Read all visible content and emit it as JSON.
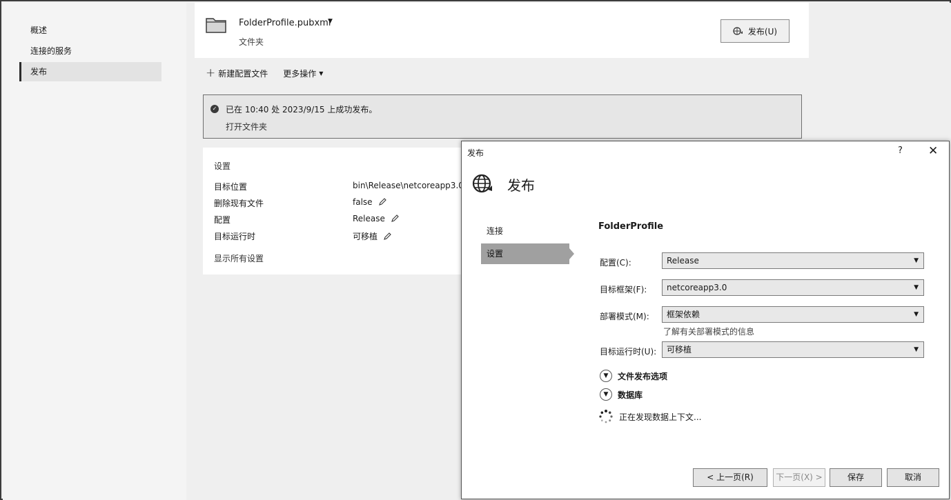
{
  "nav": {
    "items": [
      {
        "label": "概述"
      },
      {
        "label": "连接的服务"
      },
      {
        "label": "发布"
      }
    ]
  },
  "profile": {
    "name": "FolderProfile.pubxml",
    "type": "文件夹",
    "publish_button": "发布(U)"
  },
  "toolbar": {
    "new_profile": "新建配置文件",
    "more_actions": "更多操作"
  },
  "notice": {
    "message": "已在 10:40 处 2023/9/15 上成功发布。",
    "link": "打开文件夹"
  },
  "settings": {
    "heading": "设置",
    "rows": [
      {
        "label": "目标位置",
        "value": "bin\\Release\\netcoreapp3.0"
      },
      {
        "label": "删除现有文件",
        "value": "false"
      },
      {
        "label": "配置",
        "value": "Release"
      },
      {
        "label": "目标运行时",
        "value": "可移植"
      }
    ],
    "show_all": "显示所有设置"
  },
  "dialog": {
    "title": "发布",
    "help": "?",
    "close": "✕",
    "heading": "发布",
    "steps": [
      {
        "label": "连接"
      },
      {
        "label": "设置"
      }
    ],
    "profile_name": "FolderProfile",
    "fields": [
      {
        "label": "配置(C):",
        "value": "Release"
      },
      {
        "label": "目标框架(F):",
        "value": "netcoreapp3.0"
      },
      {
        "label": "部署模式(M):",
        "value": "框架依赖"
      },
      {
        "label": "目标运行时(U):",
        "value": "可移植"
      }
    ],
    "deploy_hint": "了解有关部署模式的信息",
    "expanders": [
      {
        "label": "文件发布选项"
      },
      {
        "label": "数据库"
      }
    ],
    "loading_text": "正在发现数据上下文...",
    "buttons": {
      "prev": "< 上一页(R)",
      "next": "下一页(X) >",
      "save": "保存",
      "cancel": "取消"
    }
  }
}
